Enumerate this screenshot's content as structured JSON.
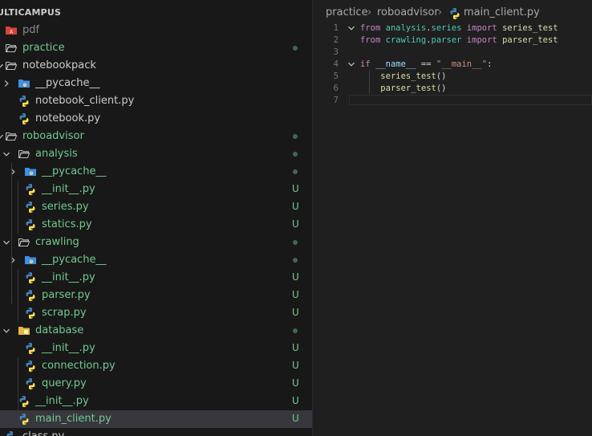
{
  "explorer": {
    "title": "ULTICAMPUS",
    "items": [
      {
        "label": "pdf",
        "type": "pdf-folder",
        "indent": 0,
        "chevron": "none",
        "color": "dim"
      },
      {
        "label": "practice",
        "type": "folder-open",
        "indent": 0,
        "chevron": "none",
        "color": "git",
        "status": "dot"
      },
      {
        "label": "notebookpack",
        "type": "folder-open",
        "indent": 0,
        "chevron": "down",
        "color": "plain"
      },
      {
        "label": "__pycache__",
        "type": "folder-blue",
        "indent": 1,
        "chevron": "right",
        "color": "plain"
      },
      {
        "label": "notebook_client.py",
        "type": "python",
        "indent": 1,
        "chevron": "none",
        "color": "plain"
      },
      {
        "label": "notebook.py",
        "type": "python",
        "indent": 1,
        "chevron": "none",
        "color": "plain"
      },
      {
        "label": "roboadvisor",
        "type": "folder-open",
        "indent": 0,
        "chevron": "down",
        "color": "git",
        "status": "dot"
      },
      {
        "label": "analysis",
        "type": "folder-open",
        "indent": 1,
        "chevron": "down",
        "color": "git",
        "status": "dot"
      },
      {
        "label": "__pycache__",
        "type": "folder-blue",
        "indent": 2,
        "chevron": "right",
        "color": "git",
        "status": "dot"
      },
      {
        "label": "__init__.py",
        "type": "python",
        "indent": 2,
        "chevron": "none",
        "color": "git",
        "status": "U"
      },
      {
        "label": "series.py",
        "type": "python",
        "indent": 2,
        "chevron": "none",
        "color": "git",
        "status": "U"
      },
      {
        "label": "statics.py",
        "type": "python",
        "indent": 2,
        "chevron": "none",
        "color": "git",
        "status": "U"
      },
      {
        "label": "crawling",
        "type": "folder-open",
        "indent": 1,
        "chevron": "down",
        "color": "git",
        "status": "dot"
      },
      {
        "label": "__pycache__",
        "type": "folder-blue",
        "indent": 2,
        "chevron": "right",
        "color": "git",
        "status": "dot"
      },
      {
        "label": "__init__.py",
        "type": "python",
        "indent": 2,
        "chevron": "none",
        "color": "git",
        "status": "U"
      },
      {
        "label": "parser.py",
        "type": "python",
        "indent": 2,
        "chevron": "none",
        "color": "git",
        "status": "U"
      },
      {
        "label": "scrap.py",
        "type": "python",
        "indent": 2,
        "chevron": "none",
        "color": "git",
        "status": "U"
      },
      {
        "label": "database",
        "type": "folder-db",
        "indent": 1,
        "chevron": "down",
        "color": "git",
        "status": "dot"
      },
      {
        "label": "__init__.py",
        "type": "python",
        "indent": 2,
        "chevron": "none",
        "color": "git",
        "status": "U"
      },
      {
        "label": "connection.py",
        "type": "python",
        "indent": 2,
        "chevron": "none",
        "color": "git",
        "status": "U"
      },
      {
        "label": "query.py",
        "type": "python",
        "indent": 2,
        "chevron": "none",
        "color": "git",
        "status": "U"
      },
      {
        "label": "__init__.py",
        "type": "python",
        "indent": 1,
        "chevron": "none",
        "color": "git",
        "status": "U"
      },
      {
        "label": "main_client.py",
        "type": "python",
        "indent": 1,
        "chevron": "none",
        "color": "git",
        "status": "U",
        "selected": true
      },
      {
        "label": "class.py",
        "type": "python",
        "indent": 0,
        "chevron": "none",
        "color": "plain"
      }
    ]
  },
  "editor": {
    "breadcrumb": [
      "practice",
      "roboadvisor",
      "main_client.py"
    ],
    "lines": [
      {
        "no": "1",
        "fold": true,
        "tokens": [
          [
            "kw",
            "from"
          ],
          [
            "op",
            " "
          ],
          [
            "mod",
            "analysis"
          ],
          [
            "op",
            "."
          ],
          [
            "mod",
            "series"
          ],
          [
            "op",
            " "
          ],
          [
            "kw",
            "import"
          ],
          [
            "op",
            " "
          ],
          [
            "fn",
            "series_test"
          ]
        ]
      },
      {
        "no": "2",
        "fold": false,
        "tokens": [
          [
            "kw",
            "from"
          ],
          [
            "op",
            " "
          ],
          [
            "mod",
            "crawling"
          ],
          [
            "op",
            "."
          ],
          [
            "mod",
            "parser"
          ],
          [
            "op",
            " "
          ],
          [
            "kw",
            "import"
          ],
          [
            "op",
            " "
          ],
          [
            "fn",
            "parser_test"
          ]
        ]
      },
      {
        "no": "3",
        "fold": false,
        "tokens": []
      },
      {
        "no": "4",
        "fold": true,
        "tokens": [
          [
            "kw",
            "if"
          ],
          [
            "op",
            " "
          ],
          [
            "dunder",
            "__name__"
          ],
          [
            "op",
            " == "
          ],
          [
            "str",
            "\"__main__\""
          ],
          [
            "op",
            ":"
          ]
        ]
      },
      {
        "no": "5",
        "fold": false,
        "tokens": [
          [
            "op",
            "    "
          ],
          [
            "fn",
            "series_test"
          ],
          [
            "op",
            "()"
          ]
        ]
      },
      {
        "no": "6",
        "fold": false,
        "tokens": [
          [
            "op",
            "    "
          ],
          [
            "fn",
            "parser_test"
          ],
          [
            "op",
            "()"
          ]
        ]
      },
      {
        "no": "7",
        "fold": false,
        "tokens": []
      }
    ]
  },
  "colors": {
    "git_added": "#73c991",
    "sidebar_bg": "#181818",
    "editor_bg": "#1f1f1f",
    "selected_bg": "#37373d",
    "keyword": "#c586c0",
    "module": "#4ec9b0",
    "function": "#dcdcaa",
    "string": "#ce9178"
  }
}
